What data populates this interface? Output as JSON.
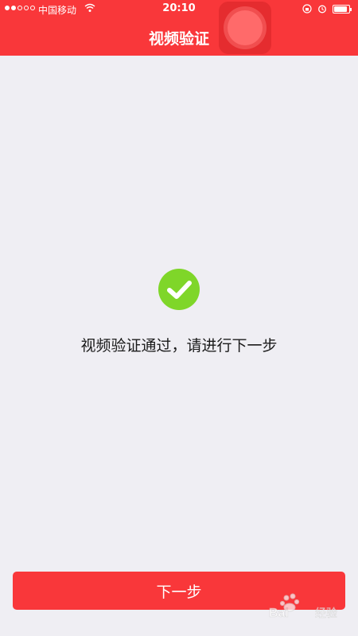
{
  "status_bar": {
    "carrier": "中国移动",
    "time": "20:10"
  },
  "header": {
    "title": "视频验证",
    "background": "#f9373a"
  },
  "icons": {
    "success": "check-circle-icon",
    "record": "record-icon"
  },
  "main": {
    "message": "视频验证通过，请进行下一步"
  },
  "footer": {
    "next_label": "下一步"
  },
  "colors": {
    "accent": "#f9373a",
    "success": "#7fd629",
    "background": "#efeef3"
  }
}
